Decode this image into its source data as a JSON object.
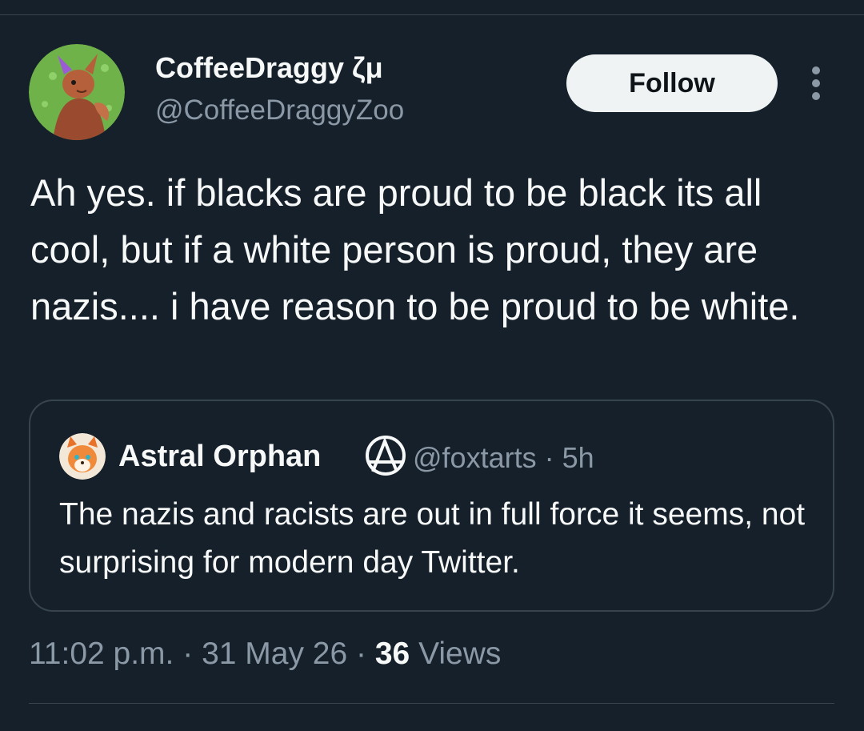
{
  "colors": {
    "background": "#15202b",
    "primary_text": "#f7f9f9",
    "secondary_text": "#8b98a5",
    "border": "#38444d",
    "follow_bg": "#eff3f4",
    "follow_text": "#0f1419"
  },
  "tweet": {
    "display_name": "CoffeeDraggy ζμ",
    "handle": "@CoffeeDraggyZoo",
    "avatar_icon": "dragon-avatar-icon",
    "follow_label": "Follow",
    "more_icon": "more-vertical-icon",
    "text": "Ah yes. if blacks are proud to be black its all cool, but if a white person is proud, they are nazis.... i have reason to be proud to be white."
  },
  "quote": {
    "display_name": "Astral Orphan",
    "badge_icon": "anarchy-symbol-icon",
    "avatar_icon": "fox-avatar-icon",
    "handle": "@foxtarts",
    "separator": " · ",
    "age": "5h",
    "text": "The nazis and racists are out in full force it seems, not surprising for modern day Twitter."
  },
  "footer": {
    "time": "11:02 p.m.",
    "separator": " · ",
    "date": "31 May 26",
    "views_count": "36",
    "views_label": " Views"
  }
}
